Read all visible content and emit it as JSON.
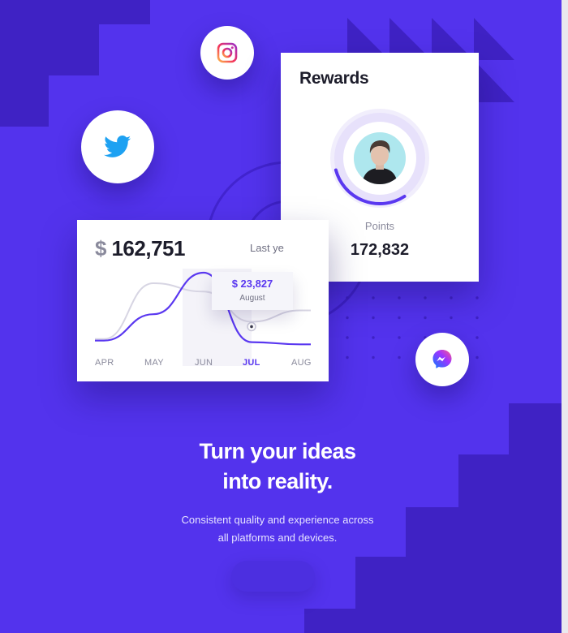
{
  "colors": {
    "background": "#5333ed",
    "accent": "#5a38f0",
    "dark_blocks": "#3f22c4"
  },
  "social_icons": [
    "instagram-icon",
    "twitter-icon",
    "messenger-icon"
  ],
  "rewards": {
    "title": "Rewards",
    "points_label": "Points",
    "points_value": "172,832",
    "progress_fraction": 0.3
  },
  "revenue": {
    "currency": "$",
    "amount": "162,751",
    "period_label": "Last ye"
  },
  "tooltip": {
    "value": "$ 23,827",
    "label": "August"
  },
  "chart_data": {
    "type": "line",
    "categories": [
      "APR",
      "MAY",
      "JUN",
      "JUL",
      "AUG"
    ],
    "active_category": "JUL",
    "series": [
      {
        "values": [
          10,
          45,
          100,
          8,
          5
        ]
      },
      {
        "values": [
          12,
          86,
          75,
          35,
          50
        ]
      }
    ]
  },
  "hero": {
    "headline_line1": "Turn your ideas",
    "headline_line2": "into reality.",
    "subtitle_line1": "Consistent quality and experience across",
    "subtitle_line2": "all platforms and devices."
  }
}
